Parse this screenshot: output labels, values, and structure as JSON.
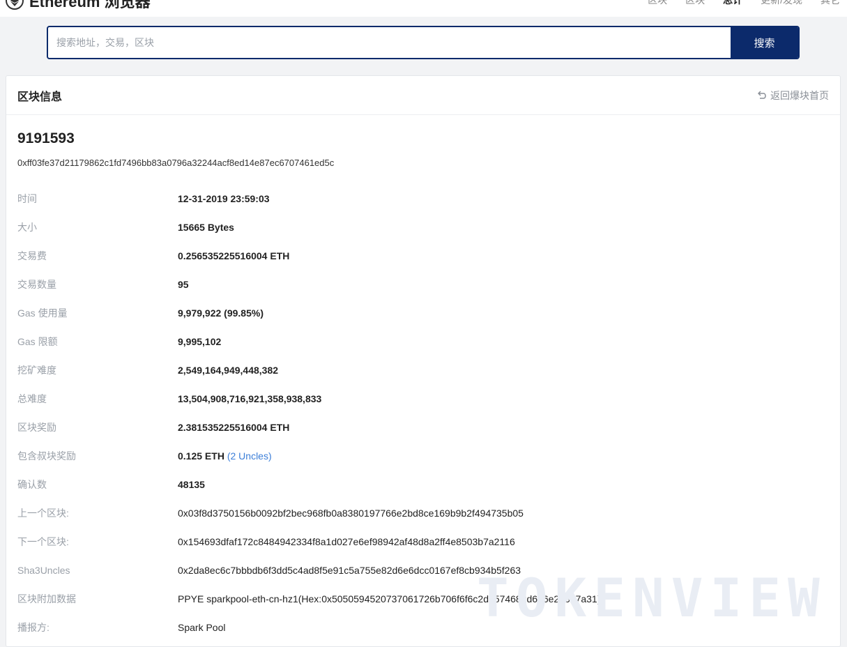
{
  "header": {
    "brand": "Ethereum 浏览器",
    "nav": [
      "区块",
      "区块",
      "总计",
      "更新/发现",
      "其它"
    ]
  },
  "search": {
    "placeholder": "搜索地址，交易，区块",
    "button": "搜索"
  },
  "card": {
    "title": "区块信息",
    "back": "返回爆块首页"
  },
  "block": {
    "number": "9191593",
    "hash": "0xff03fe37d21179862c1fd7496bb83a0796a32244acf8ed14e87ec6707461ed5c"
  },
  "rows": [
    {
      "label": "时间",
      "value": "12-31-2019 23:59:03"
    },
    {
      "label": "大小",
      "value": "15665 Bytes"
    },
    {
      "label": "交易费",
      "value": "0.256535225516004 ETH"
    },
    {
      "label": "交易数量",
      "value": "95"
    },
    {
      "label": "Gas 使用量",
      "value": "9,979,922 (99.85%)"
    },
    {
      "label": "Gas 限额",
      "value": "9,995,102"
    },
    {
      "label": "挖矿难度",
      "value": "2,549,164,949,448,382"
    },
    {
      "label": "总难度",
      "value": "13,504,908,716,921,358,938,833"
    },
    {
      "label": "区块奖励",
      "value": "2.381535225516004 ETH"
    },
    {
      "label": "包含叔块奖励",
      "value": "0.125 ETH",
      "extra": "(2 Uncles)"
    },
    {
      "label": "确认数",
      "value": "48135"
    },
    {
      "label": "上一个区块:",
      "value": "0x03f8d3750156b0092bf2bec968fb0a8380197766e2bd8ce169b9b2f494735b05"
    },
    {
      "label": "下一个区块:",
      "value": "0x154693dfaf172c8484942334f8a1d027e6ef98942af48d8a2ff4e8503b7a2116"
    },
    {
      "label": "Sha3Uncles",
      "value": "0x2da8ec6c7bbbdb6f3dd5c4ad8f5e91c5a755e82d6e6dcc0167ef8cb934b5f263"
    },
    {
      "label": "区块附加数据",
      "value": "PPYE sparkpool-eth-cn-hz1(Hex:0x5050594520737061726b706f6f6c2d6574682d636e2d687a31)"
    },
    {
      "label": "播报方:",
      "value": "Spark Pool"
    }
  ],
  "watermark": "TOKENVIEW",
  "colors": {
    "primary": "#0c2a6b",
    "link": "#3b7ed8",
    "label": "#9aa0a8"
  }
}
